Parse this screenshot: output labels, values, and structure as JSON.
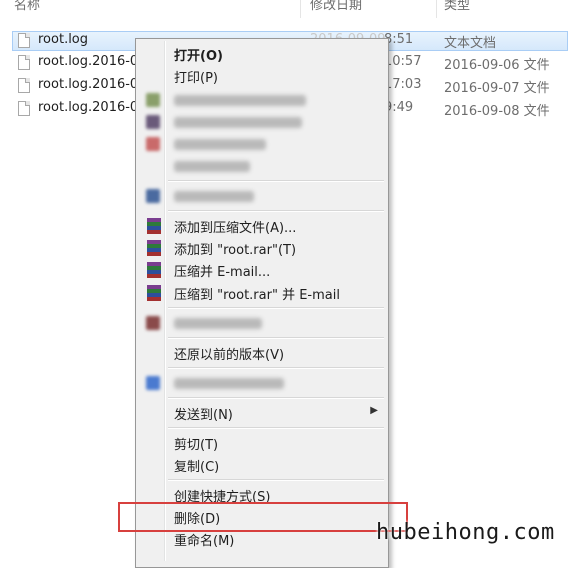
{
  "columns": {
    "name": "名称",
    "modified": "修改日期",
    "type": "类型"
  },
  "files": [
    {
      "name": "root.log",
      "date_faded": "2016-09-09",
      "time": "8:51",
      "type": "文本文档",
      "selected": true
    },
    {
      "name": "root.log.2016-0",
      "time": "10:57",
      "type": "2016-09-06 文件"
    },
    {
      "name": "root.log.2016-0",
      "time": "17:03",
      "type": "2016-09-07 文件"
    },
    {
      "name": "root.log.2016-0",
      "time": "9:49",
      "type": "2016-09-08 文件"
    }
  ],
  "menu": {
    "open": "打开(O)",
    "print": "打印(P)",
    "add_to_archive": "添加到压缩文件(A)...",
    "add_to_rar": "添加到 \"root.rar\"(T)",
    "compress_email": "压缩并 E-mail...",
    "compress_rar_email": "压缩到 \"root.rar\" 并 E-mail",
    "restore_versions": "还原以前的版本(V)",
    "send_to": "发送到(N)",
    "cut": "剪切(T)",
    "copy": "复制(C)",
    "create_shortcut": "创建快捷方式(S)",
    "delete": "删除(D)",
    "rename": "重命名(M)"
  },
  "watermark": "hubeihong.com",
  "colors": {
    "highlight_border": "#d7403e",
    "selection": "#d5e8fb",
    "menu_bg": "#f0f0f0"
  }
}
